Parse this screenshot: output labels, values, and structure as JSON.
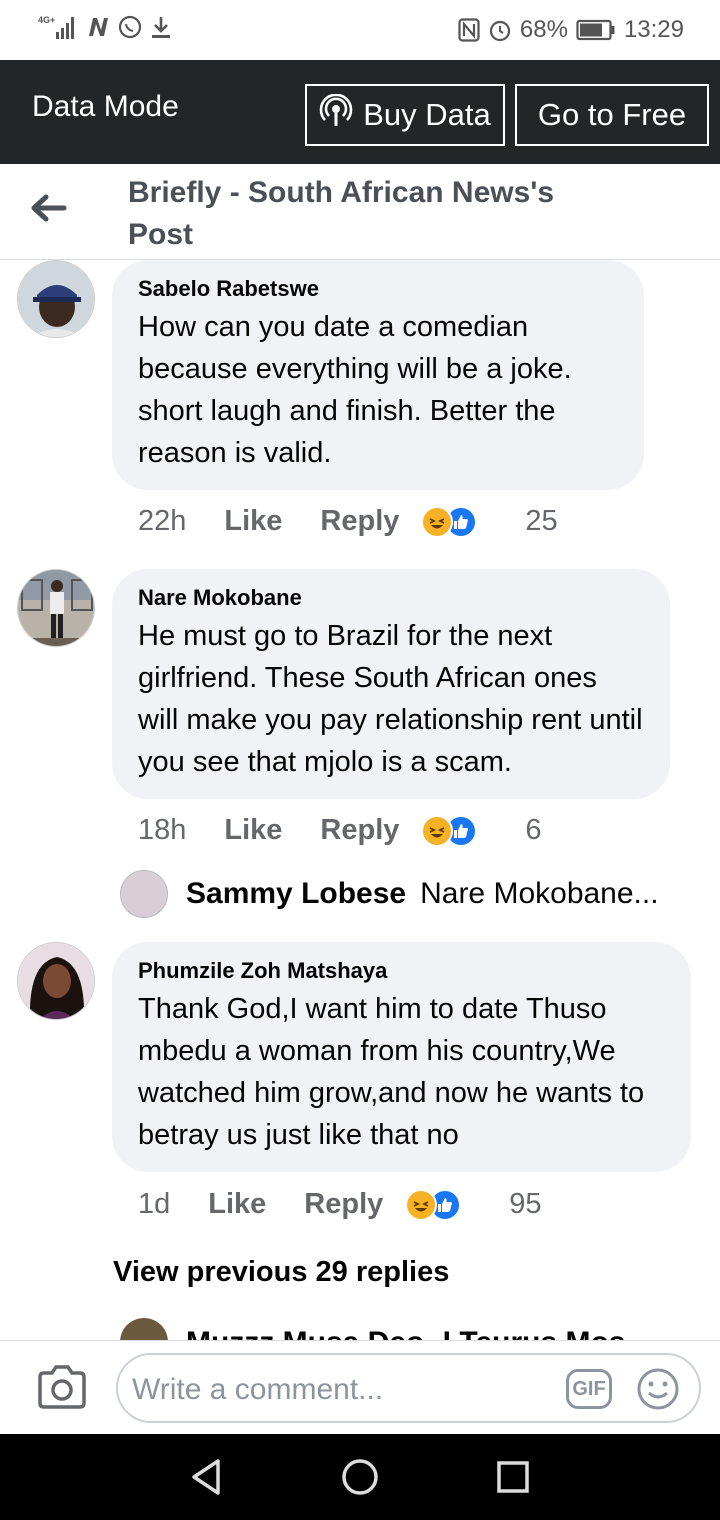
{
  "status_bar": {
    "network": "4G",
    "battery": "68%",
    "time": "13:29"
  },
  "data_bar": {
    "title": "Data Mode",
    "buy_label": "Buy Data",
    "free_label": "Go to Free"
  },
  "header": {
    "title": "Briefly - South African News's Post"
  },
  "comments": [
    {
      "author": "Sabelo Rabetswe",
      "text": "How can you date a comedian because everything will be a joke. short laugh and finish. Better the reason is valid.",
      "time": "22h",
      "like": "Like",
      "reply": "Reply",
      "count": "25"
    },
    {
      "author": "Nare Mokobane",
      "text": "He must go to Brazil for the next girlfriend. These South African ones will make you pay relationship rent until you see that mjolo is a scam.",
      "time": "18h",
      "like": "Like",
      "reply": "Reply",
      "count": "6"
    },
    {
      "author": "Phumzile Zoh Matshaya",
      "text": "Thank God,I want him to date Thuso mbedu a woman from his country,We watched him grow,and now he wants to betray us just like that no",
      "time": "1d",
      "like": "Like",
      "reply": "Reply",
      "count": "95"
    }
  ],
  "reply_preview": {
    "name": "Sammy Lobese",
    "text": "Nare Mokobane..."
  },
  "view_previous": "View previous 29 replies",
  "partial_row": "Muzzz Musa Deo- I Teurus Mos",
  "composer": {
    "placeholder": "Write a comment...",
    "gif": "GIF"
  },
  "colors": {
    "data_bar_bg": "#242526",
    "bubble_bg": "#f0f2f5",
    "like_blue": "#1877f2",
    "haha_yellow": "#f7b125"
  }
}
